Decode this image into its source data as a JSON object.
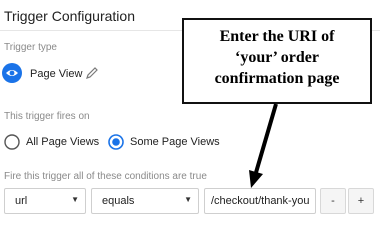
{
  "header": {
    "title": "Trigger Configuration"
  },
  "trigger_type": {
    "label": "Trigger type",
    "value": "Page View",
    "icon": "eye-icon",
    "edit_icon": "pencil-icon",
    "accent_color": "#1a73e8"
  },
  "fires_on": {
    "label": "This trigger fires on",
    "options": [
      {
        "label": "All Page Views",
        "selected": false
      },
      {
        "label": "Some Page Views",
        "selected": true
      }
    ]
  },
  "conditions": {
    "label": "Fire this trigger all of these conditions are true",
    "variable": "url",
    "operator": "equals",
    "value": "/checkout/thank-you",
    "remove_label": "-",
    "add_label": "+"
  },
  "callout": {
    "lines": [
      "Enter the URI of",
      "‘your’ order",
      "confirmation page"
    ]
  }
}
